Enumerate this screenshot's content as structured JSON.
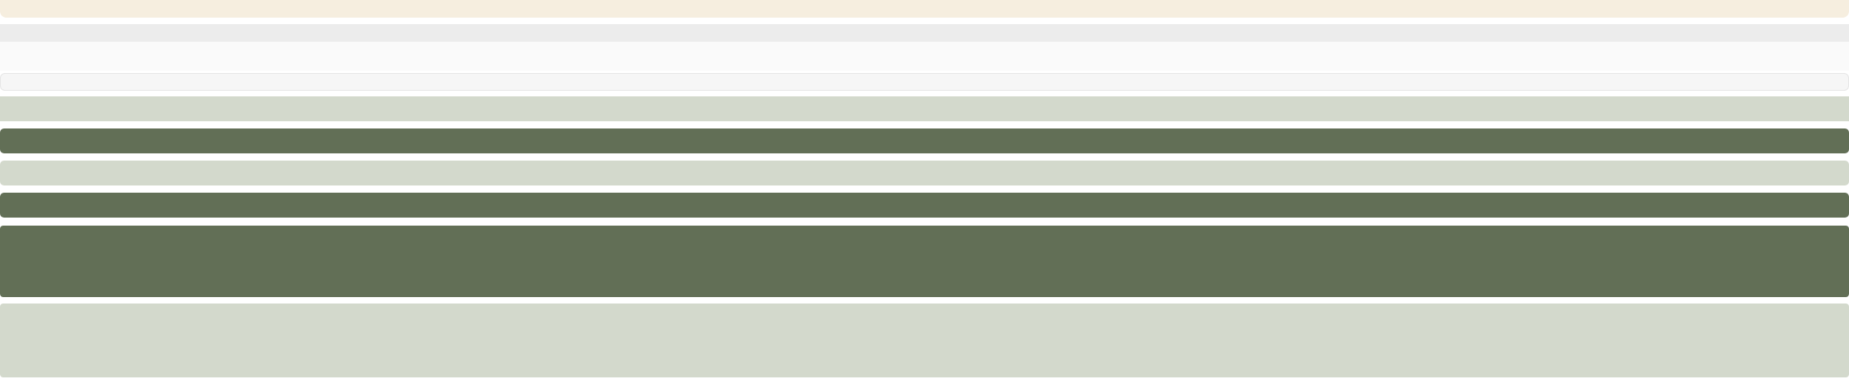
{
  "colors": {
    "banner_cream": "#f6eedf",
    "toolbar_gray": "#ececec",
    "surface_offwhite": "#fafafa",
    "input_bg": "#f6f6f6",
    "sage_light": "#d3d9cc",
    "olive_dark": "#626f56"
  },
  "bands": [
    {
      "name": "top-banner-bar",
      "color_key": "banner_cream"
    },
    {
      "name": "toolbar-strip",
      "color_key": "toolbar_gray"
    },
    {
      "name": "header-surface",
      "color_key": "surface_offwhite"
    },
    {
      "name": "search-field-bar",
      "color_key": "input_bg"
    },
    {
      "name": "filter-strip-light",
      "color_key": "sage_light"
    },
    {
      "name": "primary-action-bar",
      "color_key": "olive_dark"
    },
    {
      "name": "secondary-strip-light",
      "color_key": "sage_light"
    },
    {
      "name": "primary-action-bar-2",
      "color_key": "olive_dark"
    },
    {
      "name": "featured-panel-dark",
      "color_key": "olive_dark"
    },
    {
      "name": "content-panel-light",
      "color_key": "sage_light"
    }
  ]
}
